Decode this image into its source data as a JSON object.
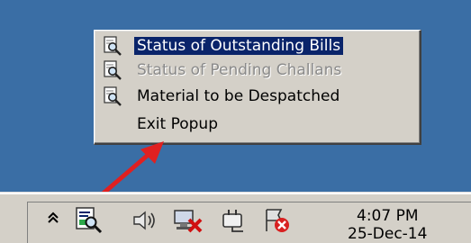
{
  "popup_menu": {
    "items": [
      {
        "label": "Status of Outstanding Bills",
        "state": "selected",
        "icon": "report-magnifier-icon"
      },
      {
        "label": "Status of Pending Challans",
        "state": "disabled",
        "icon": "report-magnifier-icon"
      },
      {
        "label": "Material to be Despatched",
        "state": "normal",
        "icon": "report-magnifier-icon"
      },
      {
        "label": "Exit Popup",
        "state": "normal",
        "icon": ""
      }
    ]
  },
  "tray": {
    "icons": [
      "show-hidden-icons-chevron",
      "app-tray-icon",
      "volume-icon",
      "network-disconnected-icon",
      "power-plug-icon",
      "action-center-error-icon"
    ],
    "clock_time": "4:07 PM",
    "clock_date": "25-Dec-14"
  },
  "colors": {
    "desktop": "#3a6ea5",
    "menu_bg": "#d4d0c8",
    "highlight": "#0a246a",
    "arrow": "#e02020",
    "disabled_text": "#8a8a8a"
  }
}
